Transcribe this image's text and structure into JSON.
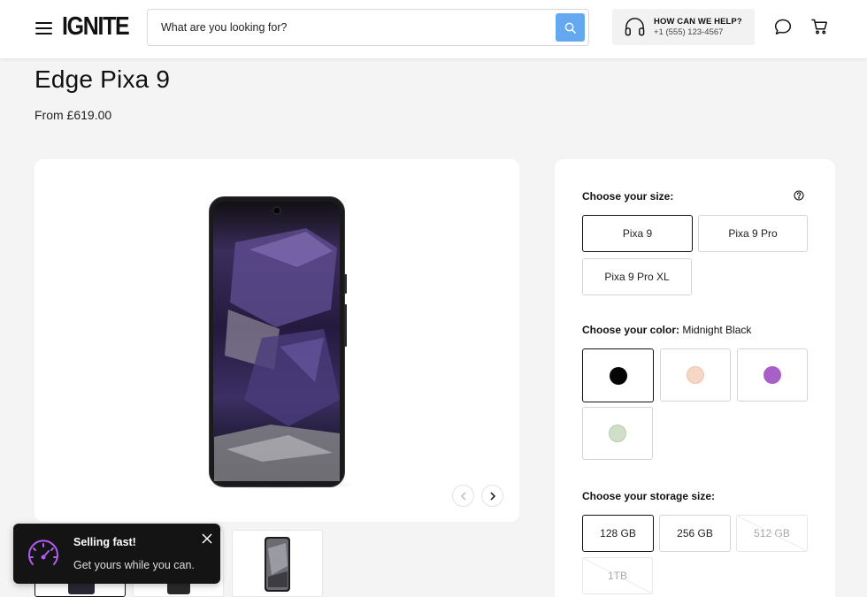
{
  "header": {
    "logo": "IGNITE",
    "search_placeholder": "What are you looking for?",
    "help_title": "HOW CAN WE HELP?",
    "help_phone": "+1 (555) 123-4567",
    "icons": [
      "menu-icon",
      "search-icon",
      "headset-icon",
      "chat-icon",
      "cart-icon"
    ]
  },
  "product": {
    "title": "Edge Pixa 9",
    "price": "From £619.00"
  },
  "toast": {
    "title": "Selling fast!",
    "message": "Get yours while you can.",
    "icon": "speedometer-icon"
  },
  "options": {
    "size": {
      "label": "Choose your size:",
      "items": [
        "Pixa 9",
        "Pixa 9 Pro",
        "Pixa 9 Pro XL"
      ],
      "selected": "Pixa 9"
    },
    "color": {
      "label": "Choose your color:",
      "selected_name": "Midnight Black",
      "swatches": [
        {
          "name": "Midnight Black",
          "hex": "#050505"
        },
        {
          "name": "Peach",
          "hex": "#f6d6c4"
        },
        {
          "name": "Purple",
          "hex": "#a95fc8"
        },
        {
          "name": "Mint",
          "hex": "#cfdfc8"
        }
      ]
    },
    "storage": {
      "label": "Choose your storage size:",
      "items": [
        "128 GB",
        "256 GB",
        "512 GB",
        "1TB"
      ],
      "selected": "128 GB",
      "unavailable": [
        "512 GB",
        "1TB"
      ]
    }
  },
  "colors": {
    "accent_search": "#64a9ef",
    "toast_bg": "#141414",
    "toast_icon": "#b15cf0"
  }
}
